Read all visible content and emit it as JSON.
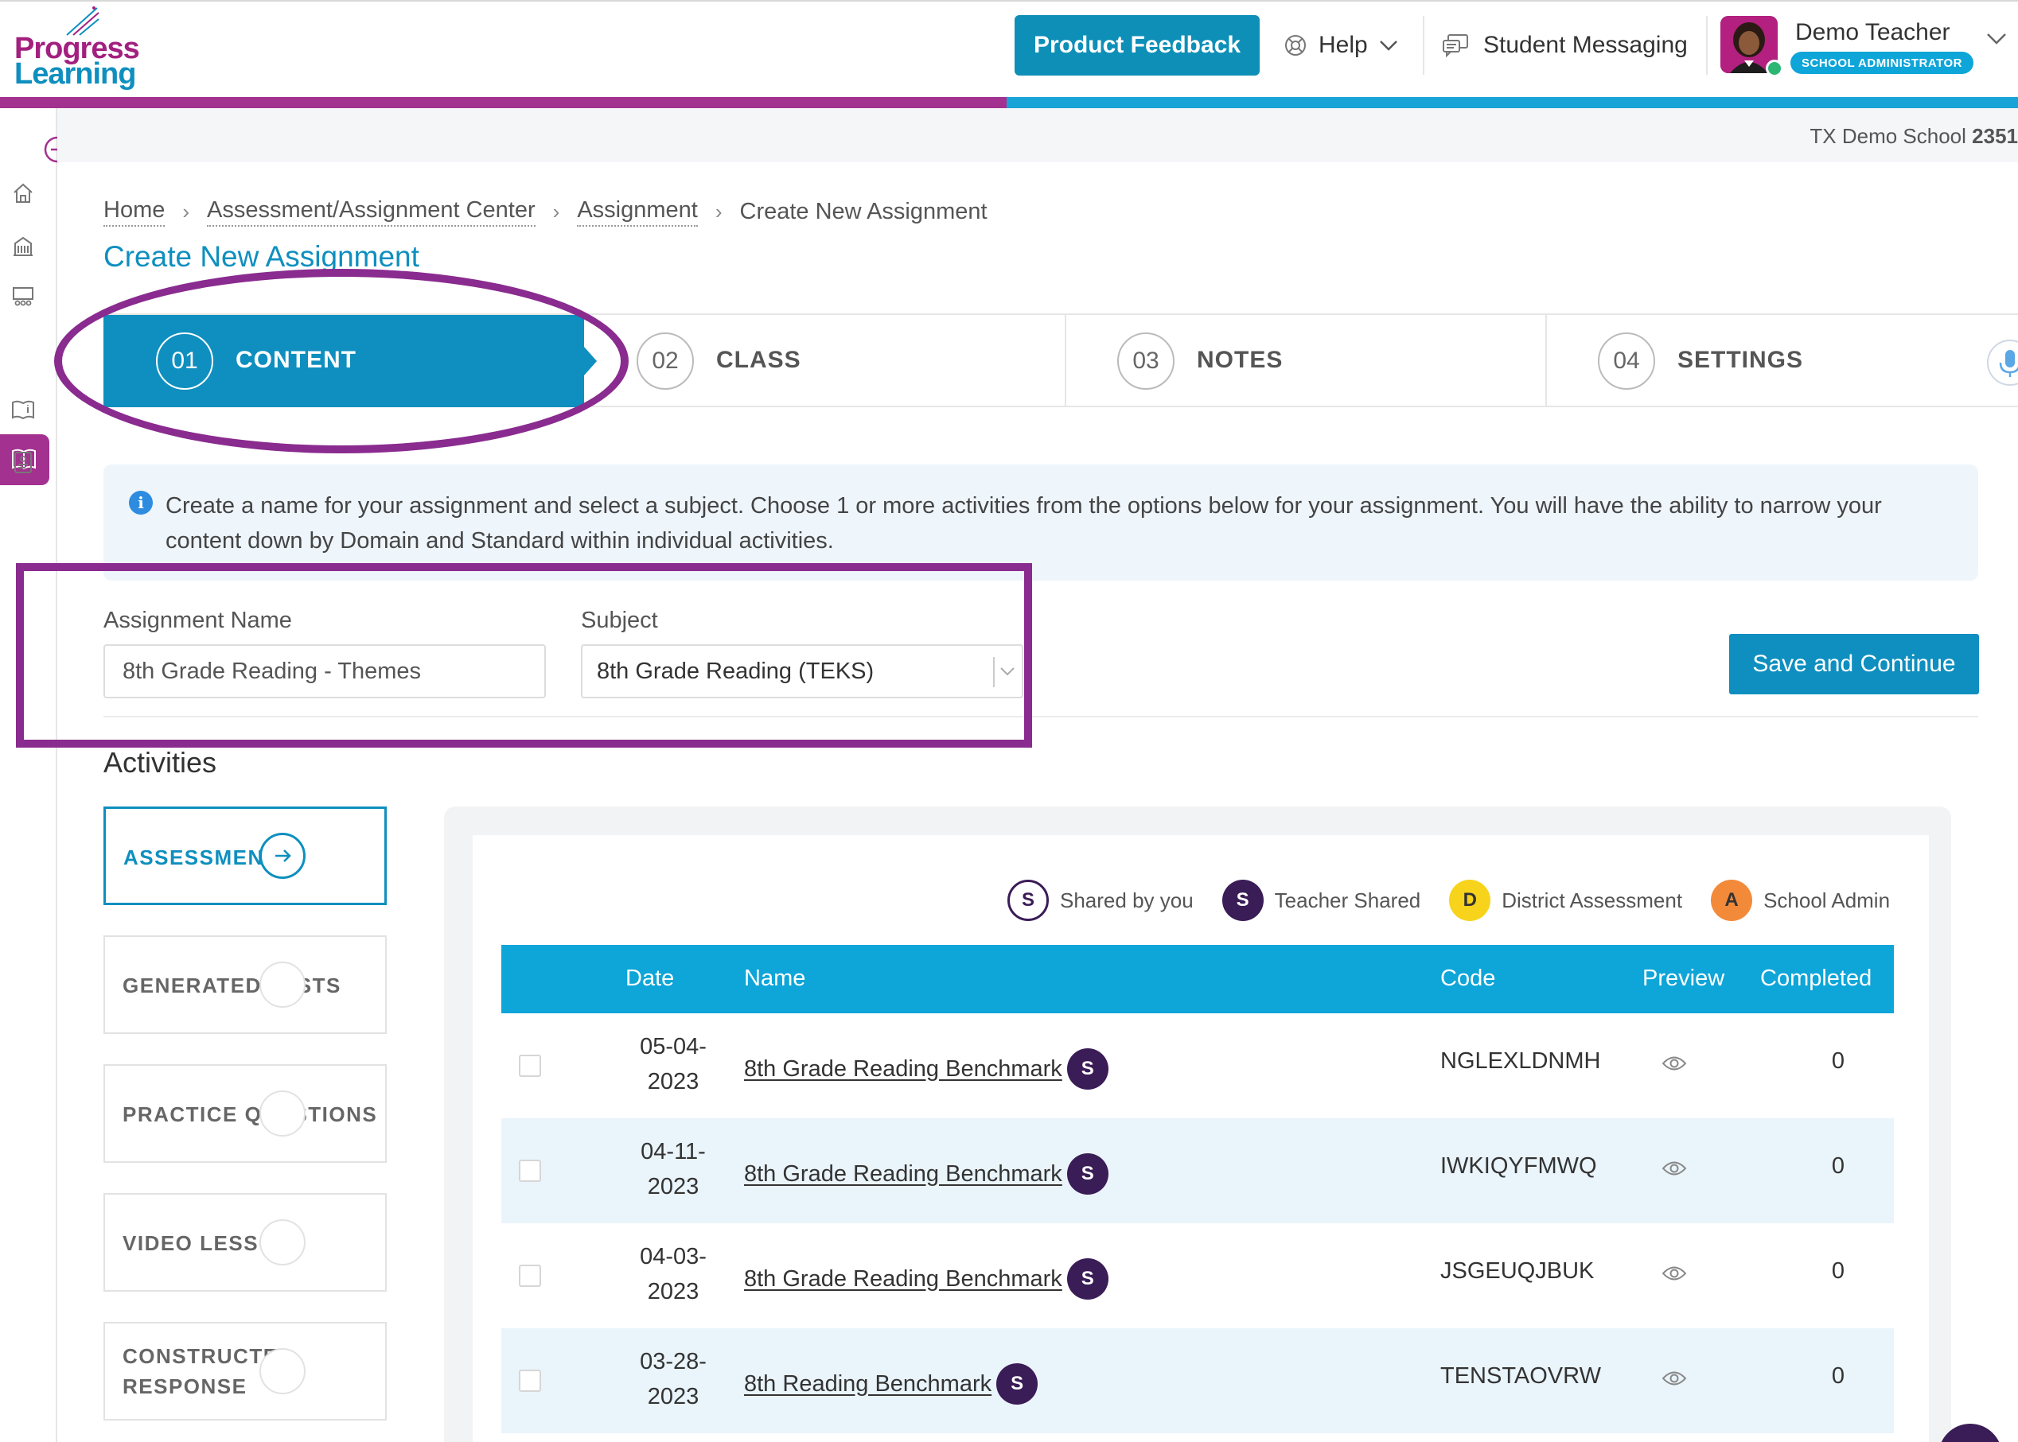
{
  "header": {
    "logo_line1": "Progress",
    "logo_line2": "Learning",
    "feedback_label": "Product Feedback",
    "help_label": "Help",
    "messaging_label": "Student Messaging",
    "user_name": "Demo Teacher",
    "user_role": "SCHOOL ADMINISTRATOR"
  },
  "school": {
    "prefix": "TX Demo School",
    "number": "2351"
  },
  "breadcrumb": [
    "Home",
    "Assessment/Assignment Center",
    "Assignment",
    "Create New Assignment"
  ],
  "page_title": "Create New Assignment",
  "steps": [
    {
      "num": "01",
      "label": "CONTENT"
    },
    {
      "num": "02",
      "label": "CLASS"
    },
    {
      "num": "03",
      "label": "NOTES"
    },
    {
      "num": "04",
      "label": "SETTINGS"
    }
  ],
  "info_text": "Create a name for your assignment and select a subject. Choose 1 or more activities from the options below for your assignment. You will have the ability to narrow your content down by Domain and Standard within individual activities.",
  "form": {
    "name_label": "Assignment Name",
    "name_value": "8th Grade Reading - Themes",
    "subject_label": "Subject",
    "subject_value": "8th Grade Reading (TEKS)",
    "save_label": "Save and Continue"
  },
  "activities": {
    "title": "Activities",
    "items": [
      "ASSESSMENT",
      "GENERATED TESTS",
      "PRACTICE QUESTIONS",
      "VIDEO LESSON",
      "CONSTRUCTED RESPONSE"
    ]
  },
  "legend": [
    {
      "badge": "S",
      "label": "Shared by you",
      "color": "#ffffff"
    },
    {
      "badge": "S",
      "label": "Teacher Shared",
      "color": "#3a1c57"
    },
    {
      "badge": "D",
      "label": "District Assessment",
      "color": "#f7d31c"
    },
    {
      "badge": "A",
      "label": "School Admin",
      "color": "#f28a3a"
    }
  ],
  "table": {
    "columns": [
      "Date",
      "Name",
      "Code",
      "Preview",
      "Completed"
    ],
    "rows": [
      {
        "date_line1": "05-04-",
        "date_line2": "2023",
        "name": "8th Grade Reading Benchmark",
        "badge": "S",
        "code": "NGLEXLDNMH",
        "completed": "0"
      },
      {
        "date_line1": "04-11-",
        "date_line2": "2023",
        "name": "8th Grade Reading Benchmark",
        "badge": "S",
        "code": "IWKIQYFMWQ",
        "completed": "0"
      },
      {
        "date_line1": "04-03-",
        "date_line2": "2023",
        "name": "8th Grade Reading Benchmark",
        "badge": "S",
        "code": "JSGEUQJBUK",
        "completed": "0"
      },
      {
        "date_line1": "03-28-",
        "date_line2": "2023",
        "name": "8th Reading Benchmark",
        "badge": "S",
        "code": "TENSTAOVRW",
        "completed": "0"
      }
    ]
  },
  "colors": {
    "primary": "#0e8fbf",
    "brand_magenta": "#a3318f",
    "annotation": "#8a2b8f",
    "table_header": "#0ea5d8"
  },
  "icons": [
    "logo-spark-icon",
    "help-lifebuoy-icon",
    "chevron-down-icon",
    "message-icon",
    "expand-arrow-icon",
    "home-icon",
    "building-icon",
    "classroom-icon",
    "book-icon",
    "book-info-icon",
    "report-icon",
    "info-icon",
    "arrow-right-icon",
    "eye-icon",
    "microphone-icon"
  ]
}
